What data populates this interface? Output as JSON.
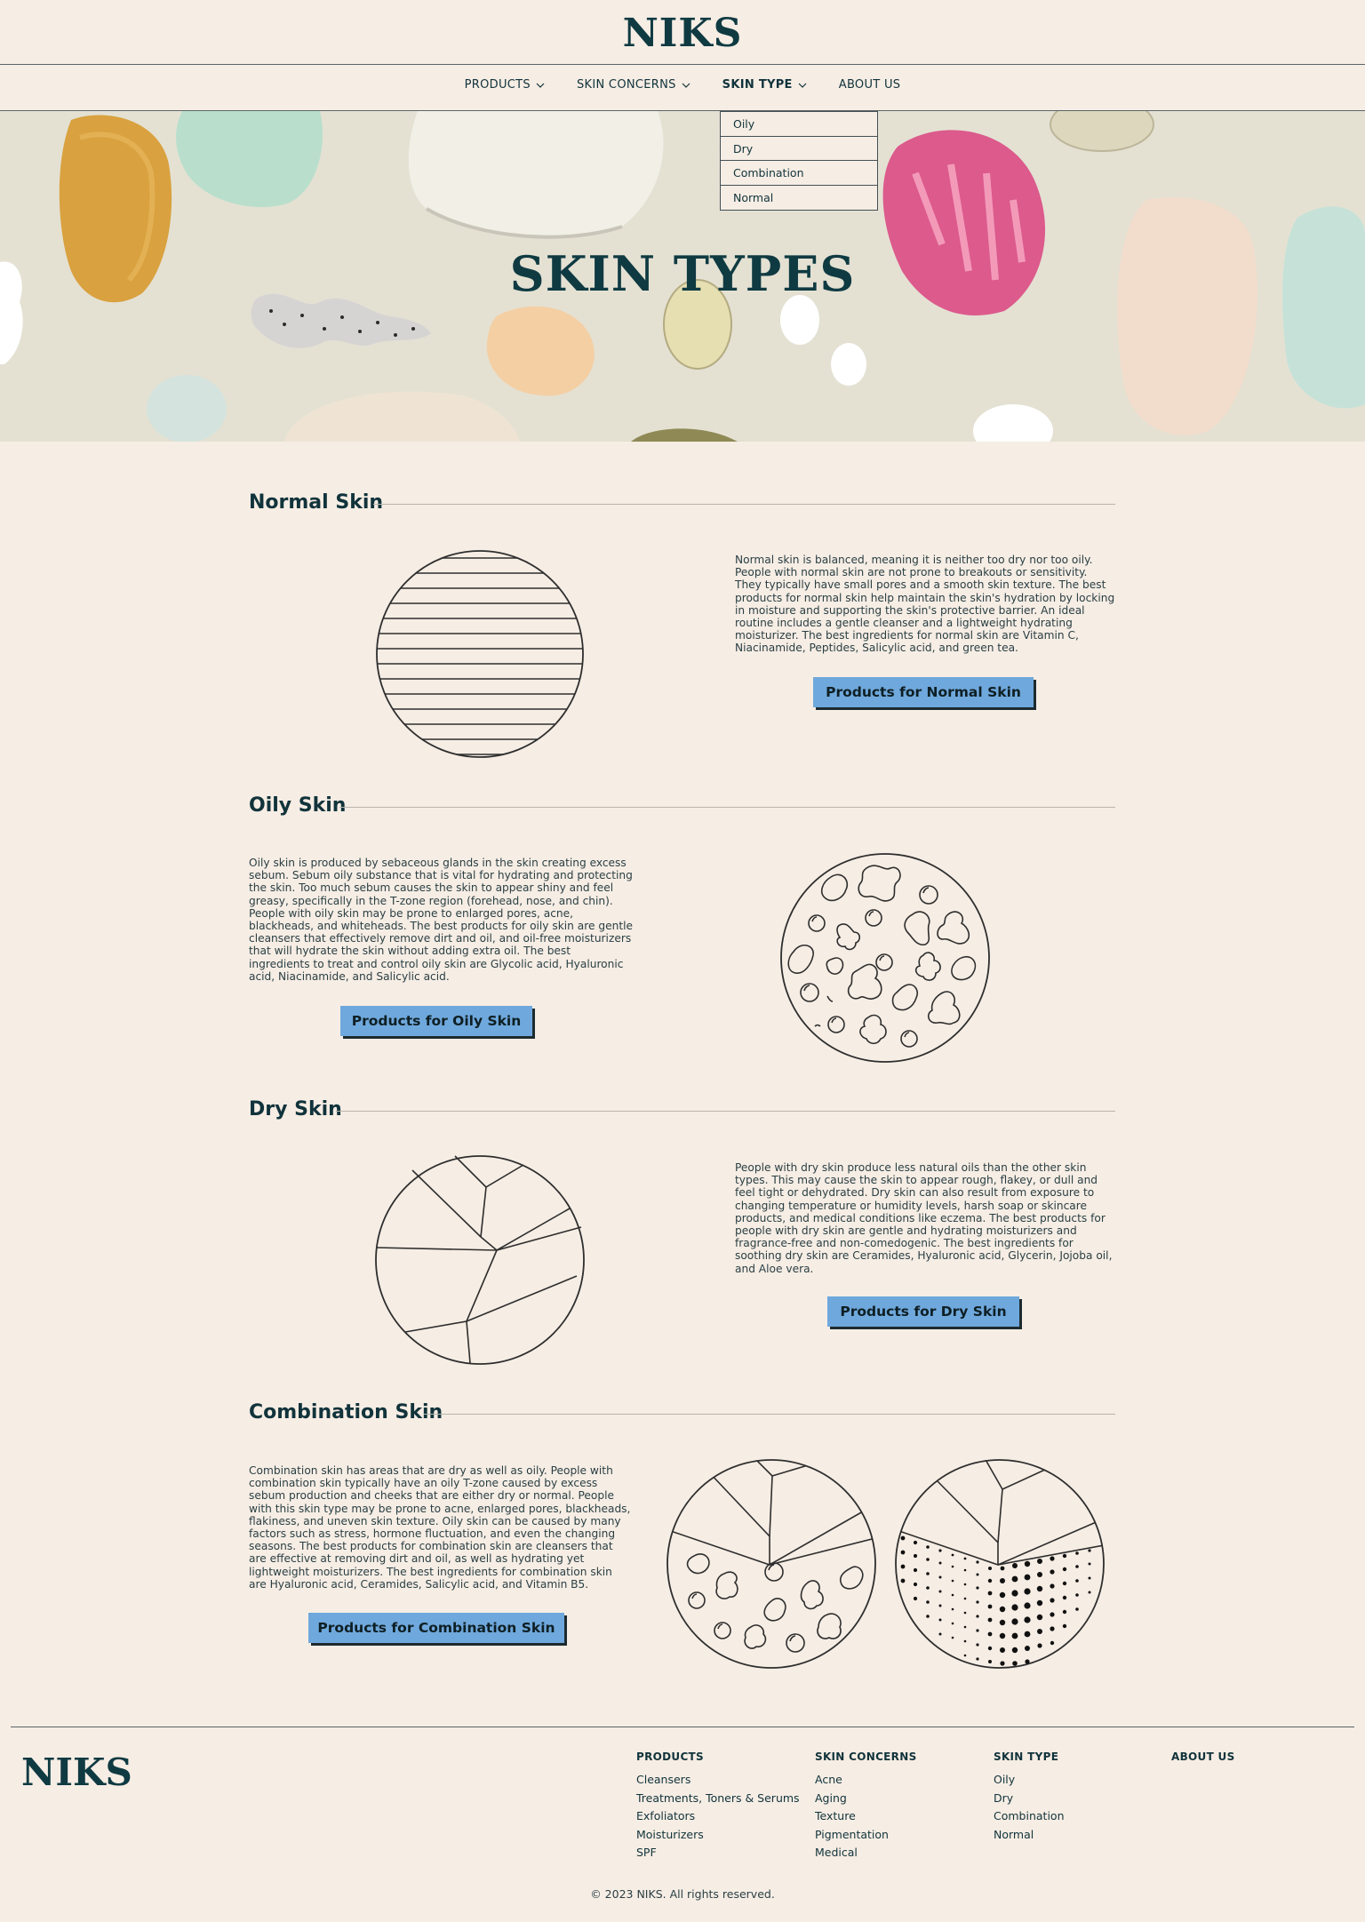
{
  "brand": "NIKS",
  "nav": [
    {
      "label": "PRODUCTS",
      "active": false
    },
    {
      "label": "SKIN CONCERNS",
      "active": false
    },
    {
      "label": "SKIN TYPE",
      "active": true
    },
    {
      "label": "ABOUT US",
      "active": false
    }
  ],
  "dropdown": [
    "Oily",
    "Dry",
    "Combination",
    "Normal"
  ],
  "hero": {
    "title": "SKIN TYPES"
  },
  "sections": [
    {
      "title": "Normal Skin",
      "description": "Normal skin is balanced, meaning it is neither too dry nor too oily. People with normal skin are not prone to breakouts or sensitivity. They typically have small pores and a smooth skin texture. The best products for normal skin help maintain the skin's hydration by locking in moisture and supporting the skin's protective barrier. An ideal routine includes a gentle cleanser and a lightweight hydrating moisturizer. The best ingredients for normal skin are Vitamin C, Niacinamide, Peptides, Salicylic acid, and green tea.",
      "button": "Products for Normal Skin"
    },
    {
      "title": "Oily Skin",
      "description": "Oily skin is produced by sebaceous glands in the skin creating excess sebum. Sebum oily substance that is vital for hydrating and protecting the skin. Too much sebum causes the skin to appear shiny and feel greasy, specifically in the T-zone region (forehead, nose, and chin). People with oily skin may be prone to enlarged pores, acne, blackheads, and whiteheads. The best products for oily skin are gentle cleansers that effectively remove dirt and oil, and oil-free moisturizers that will hydrate the skin without adding extra oil. The best ingredients to treat and control oily skin are Glycolic acid, Hyaluronic acid, Niacinamide, and Salicylic acid.",
      "button": "Products for Oily Skin"
    },
    {
      "title": "Dry Skin",
      "description": "People with dry skin produce less natural oils than the other skin types. This may cause the skin to appear rough, flakey, or dull and feel tight or dehydrated. Dry skin can also result from exposure to changing temperature or humidity levels, harsh soap or skincare products, and medical conditions like eczema. The best products for people with dry skin are gentle and hydrating moisturizers and fragrance-free and non-comedogenic. The best ingredients for soothing dry skin are Ceramides, Hyaluronic acid, Glycerin, Jojoba oil, and Aloe vera.",
      "button": "Products for Dry Skin"
    },
    {
      "title": "Combination Skin",
      "description": "Combination skin has areas that are dry as well as oily. People with combination skin typically have an oily T-zone caused by excess sebum production and cheeks that are either dry or normal. People with this skin type may be prone to acne, enlarged pores, blackheads, flakiness, and uneven skin texture. Oily skin can be caused by many factors such as stress, hormone fluctuation, and even the changing seasons. The best products for combination skin are cleansers that are effective at removing dirt and oil, as well as hydrating yet lightweight moisturizers. The best ingredients for combination skin are Hyaluronic acid, Ceramides, Salicylic acid, and Vitamin B5.",
      "button": "Products for Combination Skin"
    }
  ],
  "footer": {
    "brand": "NIKS",
    "columns": [
      {
        "heading": "PRODUCTS",
        "links": [
          "Cleansers",
          "Treatments, Toners & Serums",
          "Exfoliators",
          "Moisturizers",
          "SPF"
        ]
      },
      {
        "heading": "SKIN CONCERNS",
        "links": [
          "Acne",
          "Aging",
          "Texture",
          "Pigmentation",
          "Medical"
        ]
      },
      {
        "heading": "SKIN TYPE",
        "links": [
          "Oily",
          "Dry",
          "Combination",
          "Normal"
        ]
      },
      {
        "heading": "ABOUT US",
        "links": []
      }
    ],
    "copyright": "© 2023 NIKS. All rights reserved."
  },
  "colors": {
    "background": "#f6ede4",
    "brand": "#0f3a42",
    "button": "#6fa8dc"
  },
  "icons": [
    "chevron-down-icon"
  ]
}
